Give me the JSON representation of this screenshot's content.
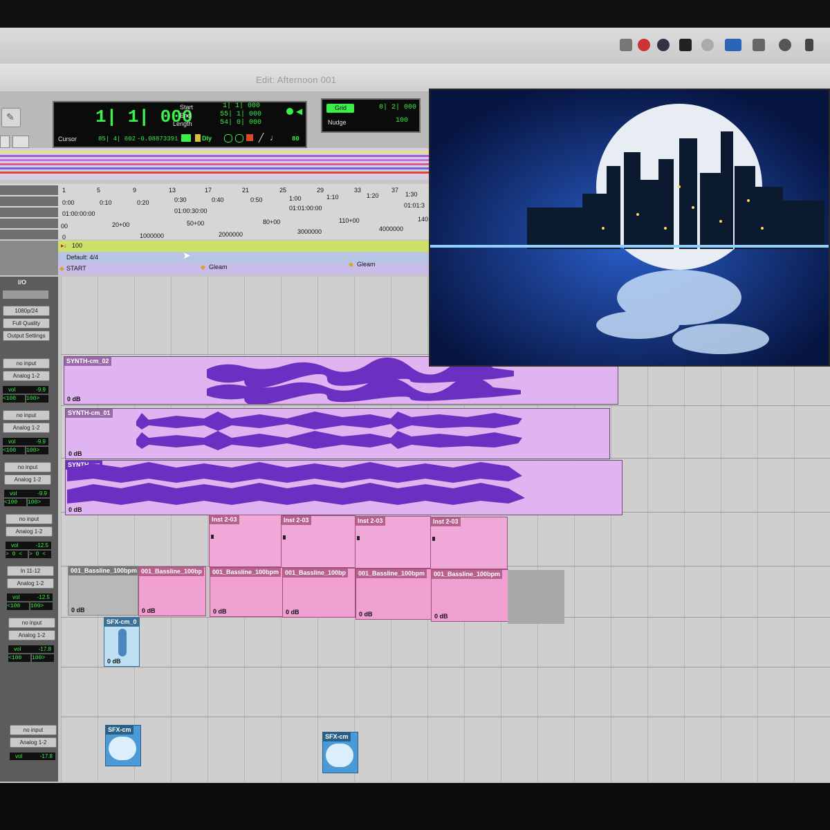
{
  "window": {
    "title": "Edit: Afternoon 001"
  },
  "transport": {
    "main_counter": "1| 1| 000",
    "start_label": "Start",
    "end_label": "End",
    "length_label": "Length",
    "start_value": "1| 1| 000",
    "end_value": "55| 1| 000",
    "length_value": "54| 0| 000",
    "cursor_label": "Cursor",
    "cursor_value": "85| 4| 602",
    "cursor_extra": "-0.08873391",
    "dly_label": "Dly",
    "tempo_value": "80"
  },
  "grid": {
    "grid_label": "Grid",
    "grid_value": "0| 2| 000",
    "nudge_label": "Nudge",
    "nudge_value": "100"
  },
  "rulers": {
    "bars": [
      "1",
      "5",
      "9",
      "13",
      "17",
      "21",
      "25",
      "29",
      "33",
      "37"
    ],
    "minsec": [
      "0:00",
      "0:10",
      "0:20",
      "0:30",
      "0:40",
      "0:50",
      "1:00",
      "1:10",
      "1:20",
      "1:30"
    ],
    "timecode": [
      "01:00:00:00",
      "01:00:30:00",
      "01:01:00:00",
      "01:01:3"
    ],
    "feet": [
      "00",
      "20+00",
      "50+00",
      "80+00",
      "110+00",
      "140"
    ],
    "samples": [
      "0",
      "1000000",
      "2000000",
      "3000000",
      "4000000"
    ]
  },
  "tempo_track": {
    "value": "100"
  },
  "meter_track": {
    "value": "Default: 4/4"
  },
  "markers": {
    "start": "START",
    "m1": "Gleam",
    "m2": "Gleam"
  },
  "io_header": "I/O",
  "video_track": {
    "format": "1080p/24",
    "quality": "Full Quality",
    "output": "Output Settings"
  },
  "tracks": [
    {
      "input": "no input",
      "output": "Analog 1-2",
      "vol_label": "vol",
      "vol": "-9.9",
      "pan_l": "<100",
      "pan_r": "100>",
      "clips": [
        {
          "name": "SYNTH-cm_02",
          "gain": "0 dB"
        }
      ]
    },
    {
      "input": "no input",
      "output": "Analog 1-2",
      "vol_label": "vol",
      "vol": "-9.9",
      "pan_l": "<100",
      "pan_r": "100>",
      "clips": [
        {
          "name": "SYNTH-cm_01",
          "gain": "0 dB"
        }
      ]
    },
    {
      "input": "no input",
      "output": "Analog 1-2",
      "vol_label": "vol",
      "vol": "-9.9",
      "pan_l": "<100",
      "pan_r": "100>",
      "clips": [
        {
          "name": "SYNTH-cm",
          "gain": "0 dB"
        }
      ]
    },
    {
      "input": "no input",
      "output": "Analog 1-2",
      "vol_label": "vol",
      "vol": "-12.5",
      "pan_l": "> 0 <",
      "pan_r": "> 0 <",
      "clips": [
        {
          "name": "Inst 2-03"
        },
        {
          "name": "Inst 2-03"
        },
        {
          "name": "Inst 2-03"
        },
        {
          "name": "Inst 2-03"
        }
      ]
    },
    {
      "input": "In 11-12",
      "output": "Analog 1-2",
      "vol_label": "vol",
      "vol": "-12.5",
      "pan_l": "<100",
      "pan_r": "100>",
      "clips": [
        {
          "name": "001_Bassline_100bpm",
          "gain": "0 dB"
        },
        {
          "name": "001_Bassline_100bp",
          "gain": "0 dB"
        },
        {
          "name": "001_Bassline_100bpm",
          "gain": "0 dB"
        },
        {
          "name": "001_Bassline_100bp",
          "gain": "0 dB"
        },
        {
          "name": "001_Bassline_100bpm",
          "gain": "0 dB"
        },
        {
          "name": "001_Bassline_100bpm",
          "gain": "0 dB"
        }
      ]
    },
    {
      "input": "no input",
      "output": "Analog 1-2",
      "vol_label": "vol",
      "vol": "-17.8",
      "pan_l": "<100",
      "pan_r": "100>",
      "clips": [
        {
          "name": "SFX-cm_0",
          "gain": "0 dB"
        }
      ]
    },
    {
      "input": "no input",
      "output": "Analog 1-2",
      "vol_label": "vol",
      "vol": "-17.8",
      "clips": [
        {
          "name": "SFX-cm"
        },
        {
          "name": "SFX-cm"
        }
      ]
    }
  ],
  "colors": {
    "synth": "#e0b4f0",
    "wave": "#6b2fc2",
    "inst": "#f0a8d8",
    "bass": "#f0a0d0",
    "sfx": "#bfe0f4",
    "lcd_green": "#3cf04a"
  }
}
